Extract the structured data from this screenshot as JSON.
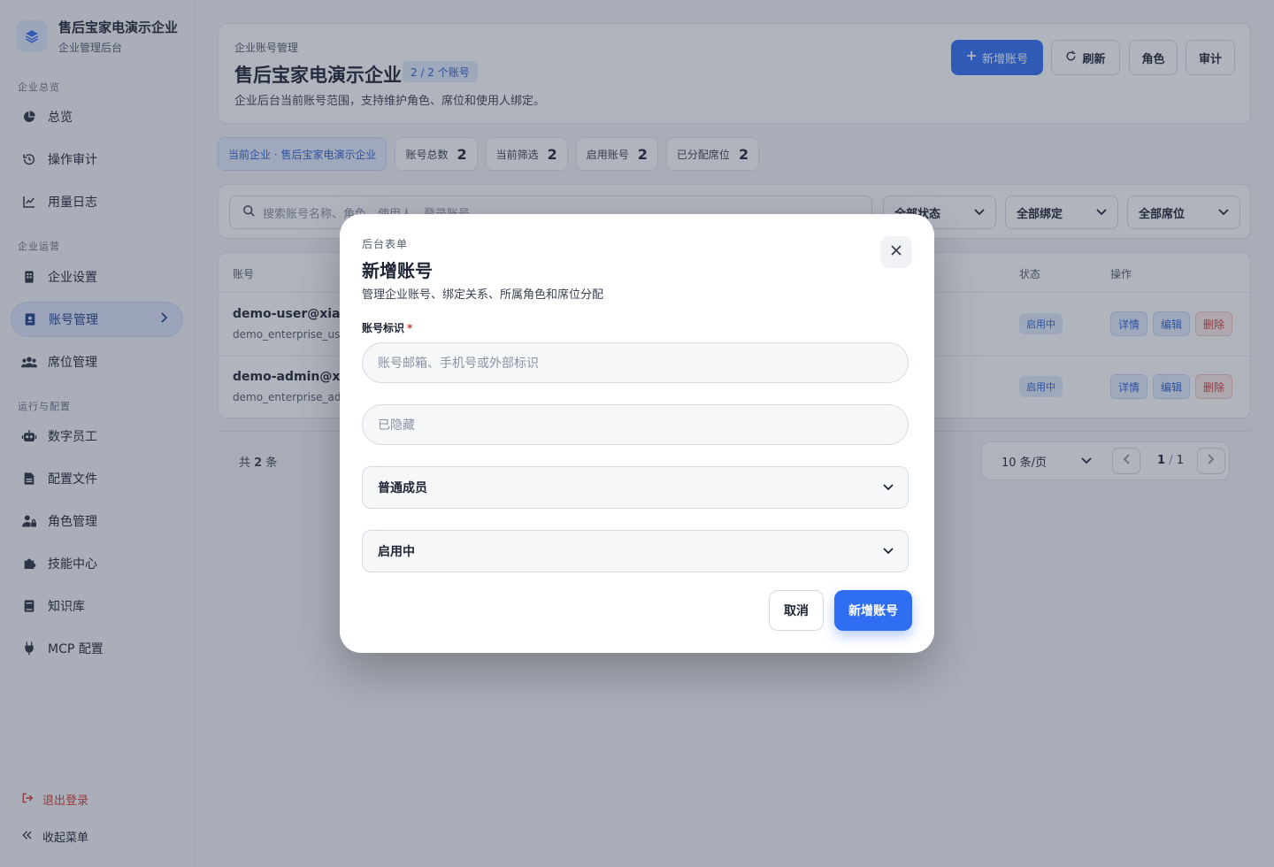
{
  "brand": {
    "name": "售后宝家电演示企业",
    "subtitle": "企业管理后台",
    "icon": "layers-icon"
  },
  "sidebar": {
    "sections": [
      {
        "title": "企业总览"
      },
      {
        "title": "企业运营"
      },
      {
        "title": "运行与配置"
      }
    ],
    "items": [
      {
        "label": "总览",
        "icon": "pie-chart-icon"
      },
      {
        "label": "操作审计",
        "icon": "history-icon"
      },
      {
        "label": "用量日志",
        "icon": "line-chart-icon"
      },
      {
        "label": "企业设置",
        "icon": "building-icon"
      },
      {
        "label": "账号管理",
        "icon": "id-card-icon",
        "active": true
      },
      {
        "label": "席位管理",
        "icon": "users-icon"
      },
      {
        "label": "数字员工",
        "icon": "robot-icon"
      },
      {
        "label": "配置文件",
        "icon": "file-icon"
      },
      {
        "label": "角色管理",
        "icon": "user-lock-icon"
      },
      {
        "label": "技能中心",
        "icon": "puzzle-icon"
      },
      {
        "label": "知识库",
        "icon": "book-icon"
      },
      {
        "label": "MCP 配置",
        "icon": "plug-icon"
      }
    ],
    "logout": "退出登录",
    "collapse": "收起菜单"
  },
  "header": {
    "crumb": "企业账号管理",
    "title": "售后宝家电演示企业",
    "badge": "2 / 2 个账号",
    "description": "企业后台当前账号范围，支持维护角色、席位和使用人绑定。",
    "buttons": {
      "add": "新增账号",
      "refresh": "刷新",
      "roles": "角色",
      "audit": "审计"
    }
  },
  "chips": {
    "current": "当前企业 · 售后宝家电演示企业",
    "stats": [
      {
        "label": "账号总数",
        "value": "2"
      },
      {
        "label": "当前筛选",
        "value": "2"
      },
      {
        "label": "启用账号",
        "value": "2"
      },
      {
        "label": "已分配席位",
        "value": "2"
      }
    ]
  },
  "filters": {
    "search_placeholder": "搜索账号名称、角色、使用人、登录账号",
    "status": "全部状态",
    "binding": "全部绑定",
    "seat": "全部席位"
  },
  "table": {
    "columns": {
      "account": "账号",
      "status": "状态",
      "actions": "操作"
    },
    "rows": [
      {
        "name": "demo-user@xiaol",
        "sub": "demo_enterprise_use",
        "status": "启用中"
      },
      {
        "name": "demo-admin@xia",
        "sub": "demo_enterprise_adr",
        "status": "启用中"
      }
    ],
    "actions": {
      "detail": "详情",
      "edit": "编辑",
      "delete": "删除"
    }
  },
  "pagination": {
    "total_prefix": "共",
    "total": "2",
    "total_suffix": "条",
    "page_size": "10 条/页",
    "current": "1",
    "sep": "/",
    "pages": "1"
  },
  "modal": {
    "eyebrow": "后台表单",
    "title": "新增账号",
    "subtitle": "管理企业账号、绑定关系、所属角色和席位分配",
    "field_label": "账号标识",
    "required_mark": "*",
    "account_placeholder": "账号邮箱、手机号或外部标识",
    "hidden_placeholder": "已隐藏",
    "role_value": "普通成员",
    "status_value": "启用中",
    "cancel": "取消",
    "submit": "新增账号"
  },
  "colors": {
    "primary": "#2f6ef2",
    "danger": "#d43a2f",
    "overlay": "rgba(48,58,82,0.38)"
  }
}
